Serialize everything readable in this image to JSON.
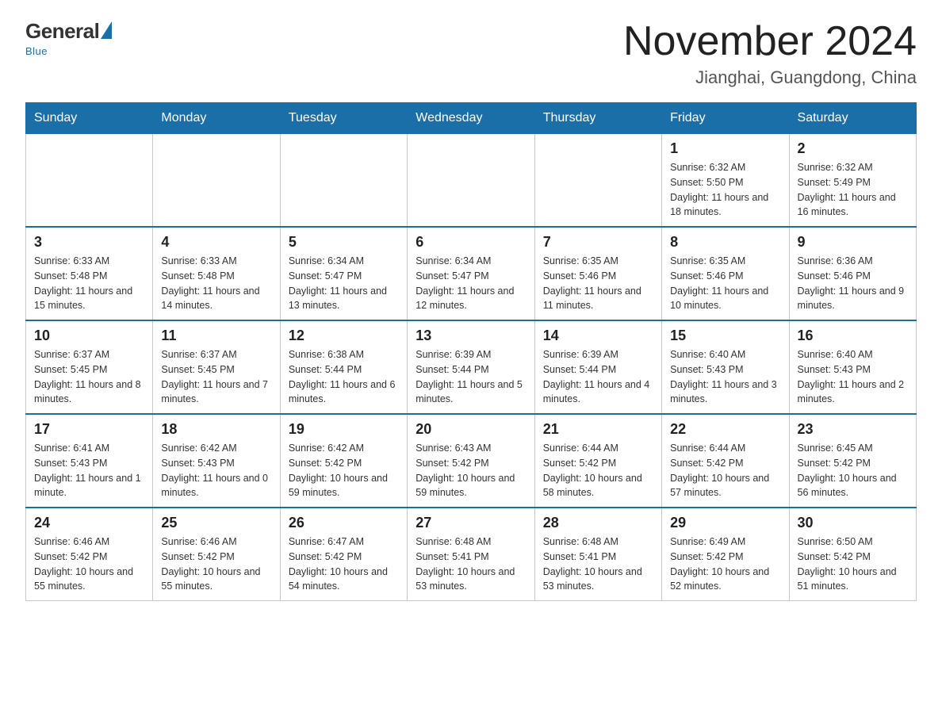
{
  "logo": {
    "general": "General",
    "blue": "Blue",
    "tagline": "Blue"
  },
  "title": {
    "month_year": "November 2024",
    "location": "Jianghai, Guangdong, China"
  },
  "weekdays": [
    "Sunday",
    "Monday",
    "Tuesday",
    "Wednesday",
    "Thursday",
    "Friday",
    "Saturday"
  ],
  "weeks": [
    [
      {
        "day": "",
        "info": ""
      },
      {
        "day": "",
        "info": ""
      },
      {
        "day": "",
        "info": ""
      },
      {
        "day": "",
        "info": ""
      },
      {
        "day": "",
        "info": ""
      },
      {
        "day": "1",
        "info": "Sunrise: 6:32 AM\nSunset: 5:50 PM\nDaylight: 11 hours and 18 minutes."
      },
      {
        "day": "2",
        "info": "Sunrise: 6:32 AM\nSunset: 5:49 PM\nDaylight: 11 hours and 16 minutes."
      }
    ],
    [
      {
        "day": "3",
        "info": "Sunrise: 6:33 AM\nSunset: 5:48 PM\nDaylight: 11 hours and 15 minutes."
      },
      {
        "day": "4",
        "info": "Sunrise: 6:33 AM\nSunset: 5:48 PM\nDaylight: 11 hours and 14 minutes."
      },
      {
        "day": "5",
        "info": "Sunrise: 6:34 AM\nSunset: 5:47 PM\nDaylight: 11 hours and 13 minutes."
      },
      {
        "day": "6",
        "info": "Sunrise: 6:34 AM\nSunset: 5:47 PM\nDaylight: 11 hours and 12 minutes."
      },
      {
        "day": "7",
        "info": "Sunrise: 6:35 AM\nSunset: 5:46 PM\nDaylight: 11 hours and 11 minutes."
      },
      {
        "day": "8",
        "info": "Sunrise: 6:35 AM\nSunset: 5:46 PM\nDaylight: 11 hours and 10 minutes."
      },
      {
        "day": "9",
        "info": "Sunrise: 6:36 AM\nSunset: 5:46 PM\nDaylight: 11 hours and 9 minutes."
      }
    ],
    [
      {
        "day": "10",
        "info": "Sunrise: 6:37 AM\nSunset: 5:45 PM\nDaylight: 11 hours and 8 minutes."
      },
      {
        "day": "11",
        "info": "Sunrise: 6:37 AM\nSunset: 5:45 PM\nDaylight: 11 hours and 7 minutes."
      },
      {
        "day": "12",
        "info": "Sunrise: 6:38 AM\nSunset: 5:44 PM\nDaylight: 11 hours and 6 minutes."
      },
      {
        "day": "13",
        "info": "Sunrise: 6:39 AM\nSunset: 5:44 PM\nDaylight: 11 hours and 5 minutes."
      },
      {
        "day": "14",
        "info": "Sunrise: 6:39 AM\nSunset: 5:44 PM\nDaylight: 11 hours and 4 minutes."
      },
      {
        "day": "15",
        "info": "Sunrise: 6:40 AM\nSunset: 5:43 PM\nDaylight: 11 hours and 3 minutes."
      },
      {
        "day": "16",
        "info": "Sunrise: 6:40 AM\nSunset: 5:43 PM\nDaylight: 11 hours and 2 minutes."
      }
    ],
    [
      {
        "day": "17",
        "info": "Sunrise: 6:41 AM\nSunset: 5:43 PM\nDaylight: 11 hours and 1 minute."
      },
      {
        "day": "18",
        "info": "Sunrise: 6:42 AM\nSunset: 5:43 PM\nDaylight: 11 hours and 0 minutes."
      },
      {
        "day": "19",
        "info": "Sunrise: 6:42 AM\nSunset: 5:42 PM\nDaylight: 10 hours and 59 minutes."
      },
      {
        "day": "20",
        "info": "Sunrise: 6:43 AM\nSunset: 5:42 PM\nDaylight: 10 hours and 59 minutes."
      },
      {
        "day": "21",
        "info": "Sunrise: 6:44 AM\nSunset: 5:42 PM\nDaylight: 10 hours and 58 minutes."
      },
      {
        "day": "22",
        "info": "Sunrise: 6:44 AM\nSunset: 5:42 PM\nDaylight: 10 hours and 57 minutes."
      },
      {
        "day": "23",
        "info": "Sunrise: 6:45 AM\nSunset: 5:42 PM\nDaylight: 10 hours and 56 minutes."
      }
    ],
    [
      {
        "day": "24",
        "info": "Sunrise: 6:46 AM\nSunset: 5:42 PM\nDaylight: 10 hours and 55 minutes."
      },
      {
        "day": "25",
        "info": "Sunrise: 6:46 AM\nSunset: 5:42 PM\nDaylight: 10 hours and 55 minutes."
      },
      {
        "day": "26",
        "info": "Sunrise: 6:47 AM\nSunset: 5:42 PM\nDaylight: 10 hours and 54 minutes."
      },
      {
        "day": "27",
        "info": "Sunrise: 6:48 AM\nSunset: 5:41 PM\nDaylight: 10 hours and 53 minutes."
      },
      {
        "day": "28",
        "info": "Sunrise: 6:48 AM\nSunset: 5:41 PM\nDaylight: 10 hours and 53 minutes."
      },
      {
        "day": "29",
        "info": "Sunrise: 6:49 AM\nSunset: 5:42 PM\nDaylight: 10 hours and 52 minutes."
      },
      {
        "day": "30",
        "info": "Sunrise: 6:50 AM\nSunset: 5:42 PM\nDaylight: 10 hours and 51 minutes."
      }
    ]
  ]
}
